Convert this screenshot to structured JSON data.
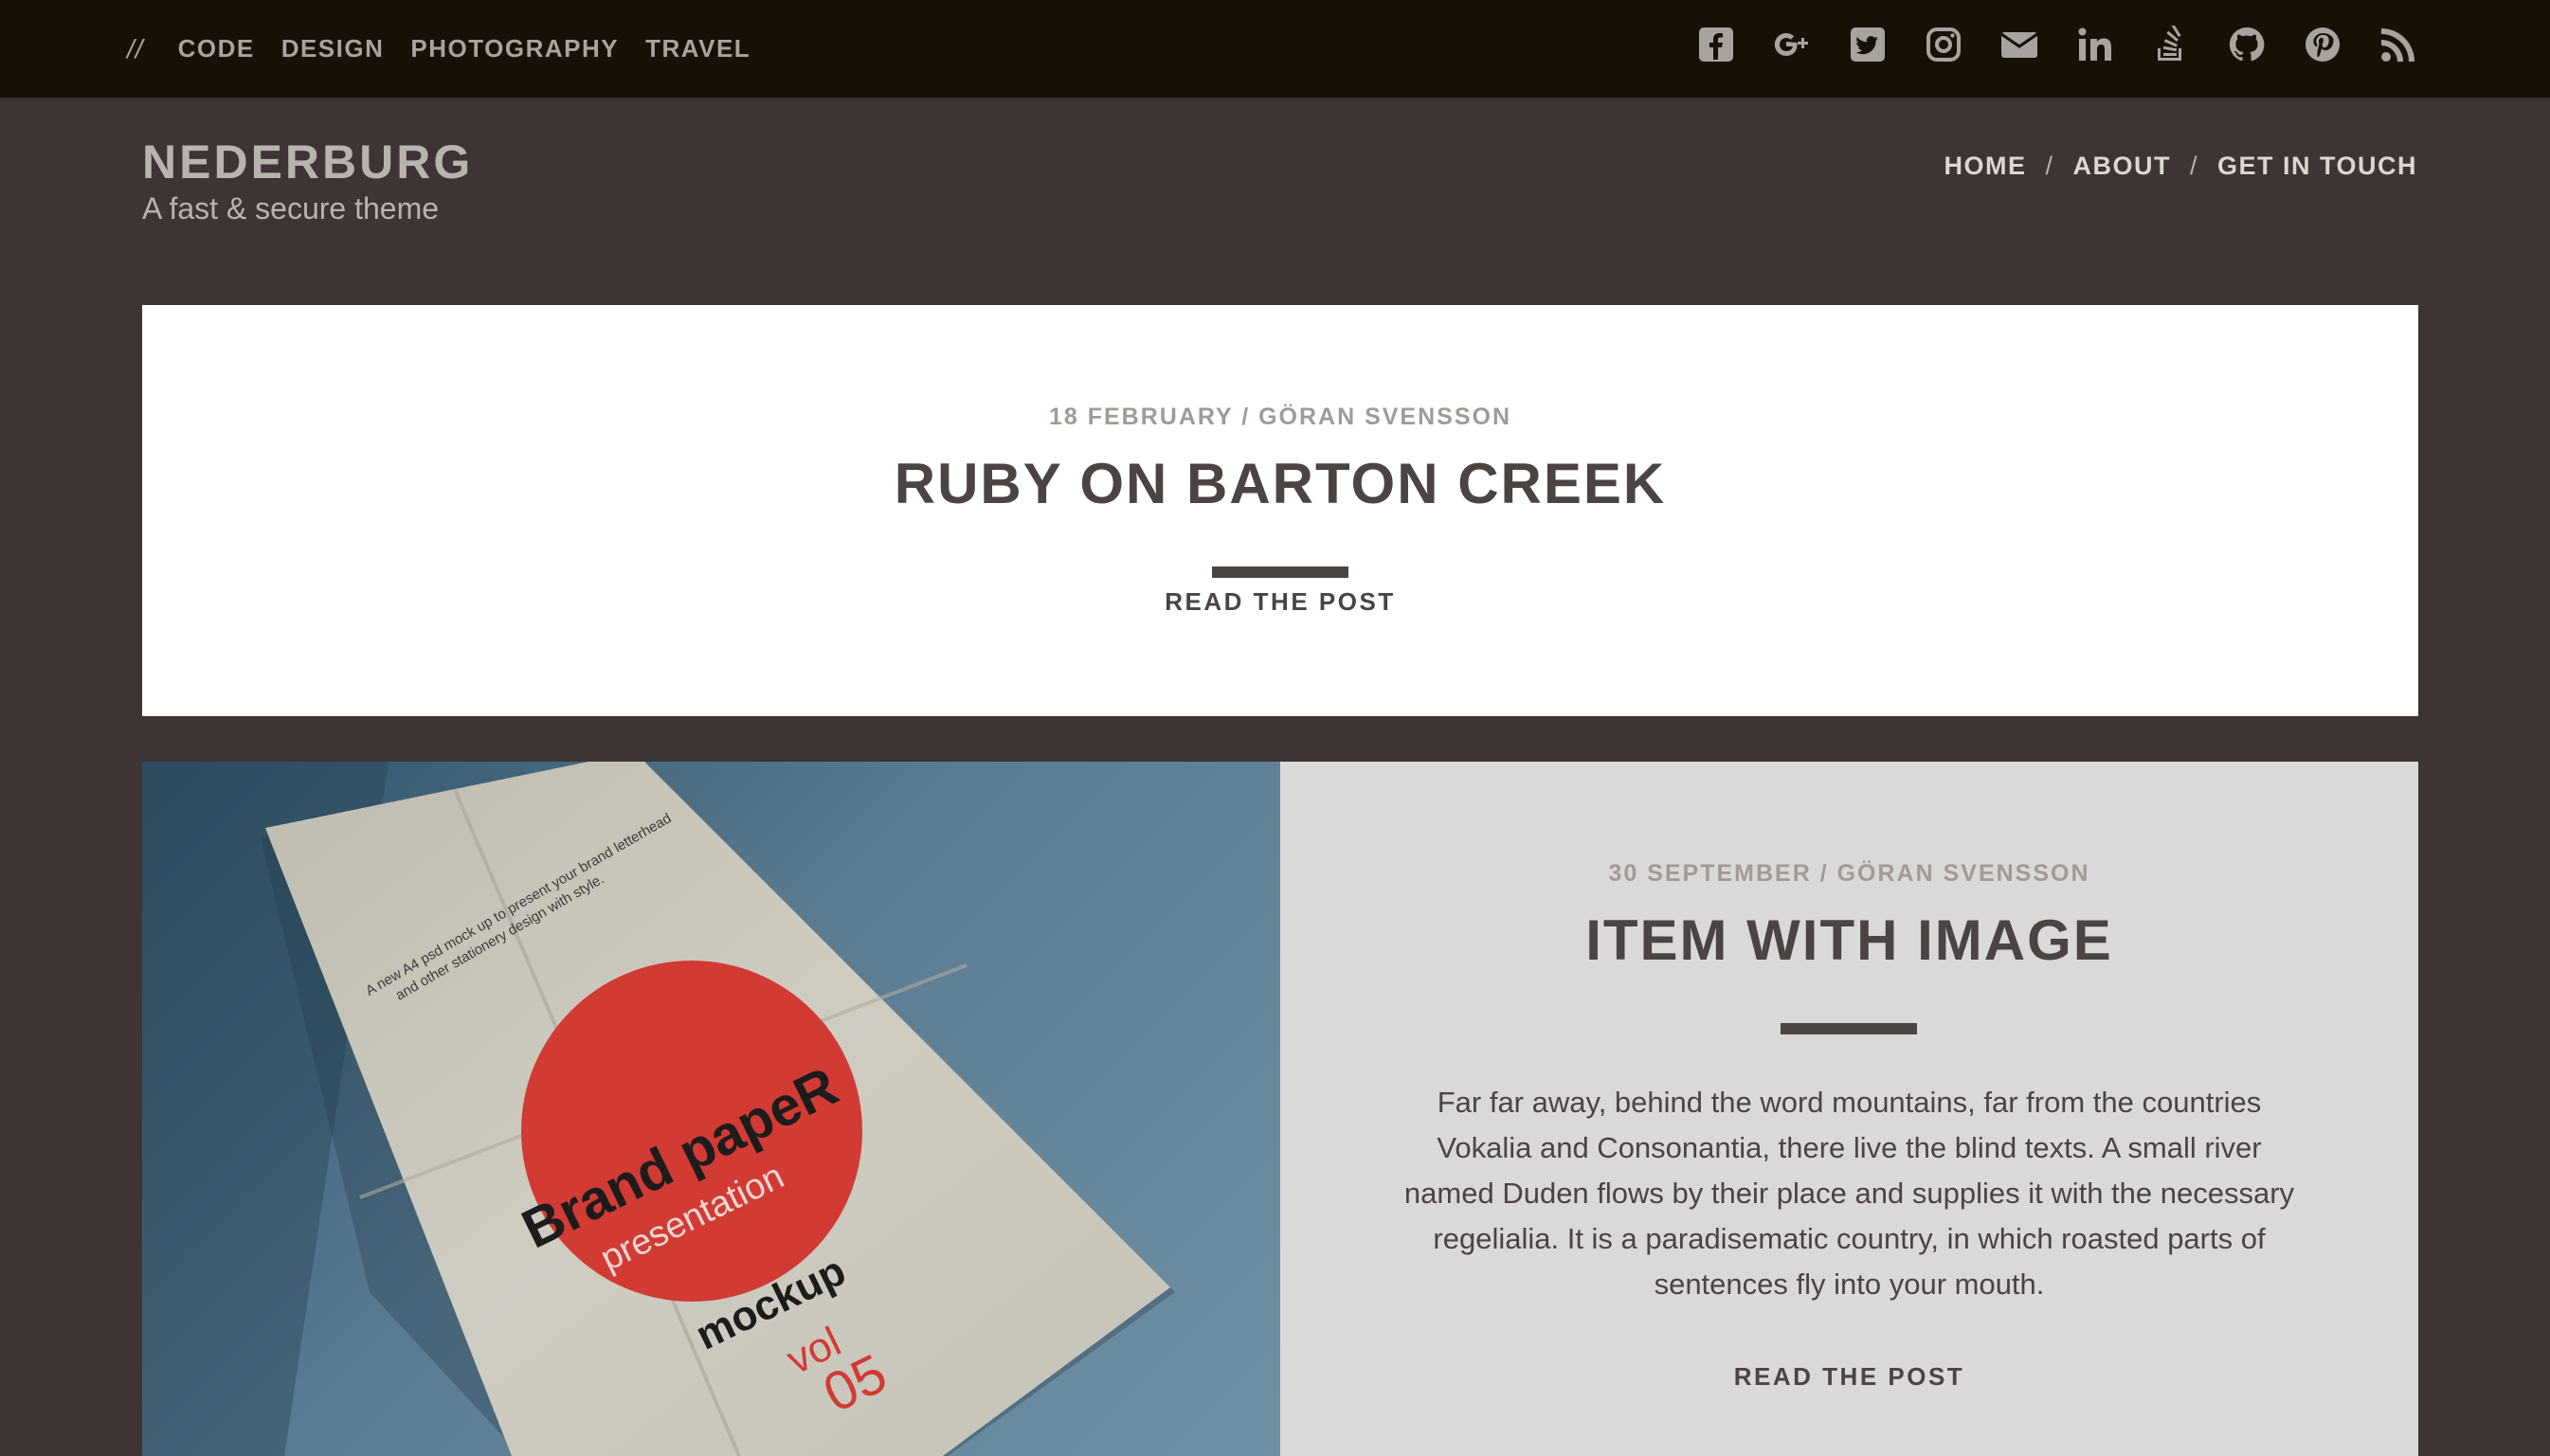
{
  "topbar": {
    "slashes": "//",
    "categories": [
      "CODE",
      "DESIGN",
      "PHOTOGRAPHY",
      "TRAVEL"
    ],
    "social_icons": [
      "facebook-icon",
      "google-plus-icon",
      "twitter-icon",
      "instagram-icon",
      "email-icon",
      "linkedin-icon",
      "stackoverflow-icon",
      "github-icon",
      "pinterest-icon",
      "rss-icon"
    ]
  },
  "site": {
    "name": "NEDERBURG",
    "tagline": "A fast & secure theme"
  },
  "mainnav": {
    "home": "HOME",
    "about": "ABOUT",
    "contact": "GET IN TOUCH",
    "separator": "/"
  },
  "posts": [
    {
      "meta": "18 FEBRUARY / GÖRAN SVENSSON",
      "title": "RUBY ON BARTON CREEK",
      "read_more": "READ THE POST"
    },
    {
      "meta": "30 SEPTEMBER / GÖRAN SVENSSON",
      "title": "ITEM WITH IMAGE",
      "excerpt": "Far far away, behind the word mountains, far from the countries Vokalia and Consonantia, there live the blind texts. A small river named Duden flows by their place and supplies it with the necessary regelialia. It is a paradisematic country, in which roasted parts of sentences fly into your mouth.",
      "read_more": "READ THE POST",
      "image": {
        "header_line1": "A new A4 psd mock up to present your brand letterhead",
        "header_line2": "and other stationery design with style.",
        "brand": "Brand papeR",
        "sub": "presentation",
        "mockup": "mockup",
        "vol": "vol",
        "num": "05"
      }
    }
  ],
  "colors": {
    "topbar_bg": "#171004",
    "page_bg": "#3d3433",
    "card_bg": "#ffffff",
    "card2_bg": "#dbd8d8",
    "text_dark": "#4a4443",
    "muted": "#a19a96",
    "accent_red": "#d23a34"
  }
}
